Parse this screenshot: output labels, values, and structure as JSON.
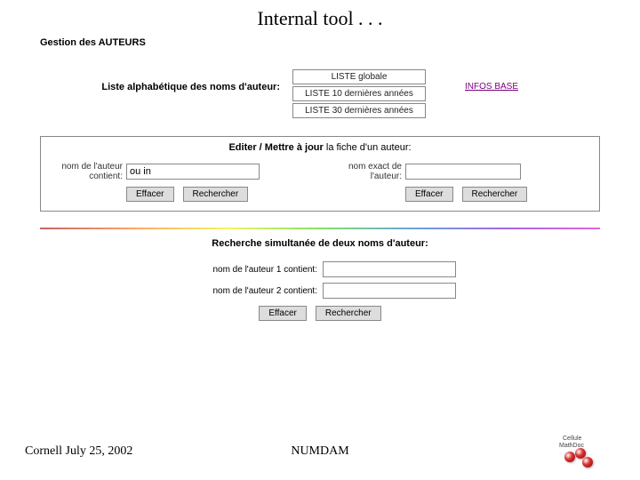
{
  "title": "Internal tool . . .",
  "section_header": "Gestion des AUTEURS",
  "alpha": {
    "label": "Liste alphabétique des noms d'auteur:",
    "buttons": [
      "LISTE globale",
      "LISTE 10 dernières années",
      "LISTE 30 dernières années"
    ],
    "infos_link": "INFOS BASE"
  },
  "edit_panel": {
    "title_bold": "Editer / Mettre à jour",
    "title_rest": "la fiche d'un auteur:",
    "left": {
      "label": "nom de l'auteur contient:",
      "value": "ou in"
    },
    "right": {
      "label": "nom exact de l'auteur:",
      "value": ""
    }
  },
  "double_search": {
    "title": "Recherche simultanée de deux noms d'auteur:",
    "row1_label": "nom de l'auteur 1 contient:",
    "row1_value": "",
    "row2_label": "nom de l'auteur 2 contient:",
    "row2_value": ""
  },
  "buttons": {
    "effacer": "Effacer",
    "rechercher": "Rechercher"
  },
  "footer": {
    "left": "Cornell July 25, 2002",
    "center": "NUMDAM",
    "logo_top": "Cellule",
    "logo_bot": "MathDoc"
  }
}
